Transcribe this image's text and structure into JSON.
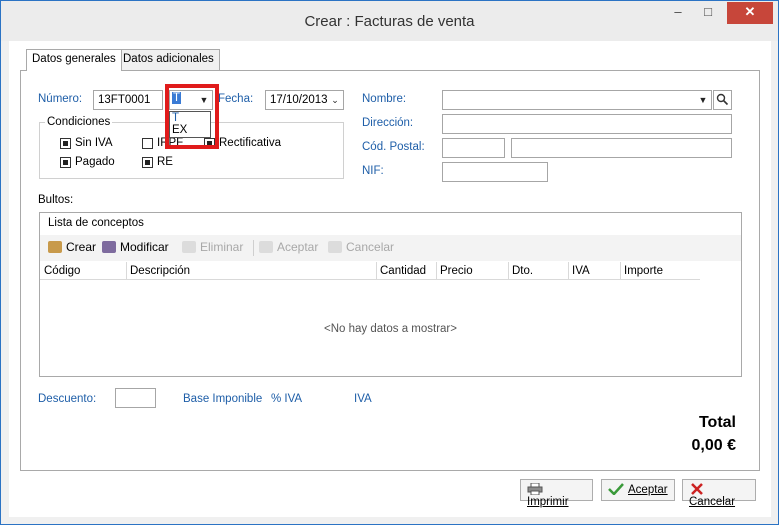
{
  "window": {
    "title": "Crear : Facturas de venta",
    "minimize": "–",
    "maximize": "□",
    "close": "✕"
  },
  "tabs": [
    {
      "label": "Datos generales"
    },
    {
      "label": "Datos adicionales"
    }
  ],
  "form": {
    "numero_label": "Número:",
    "numero_value": "13FT0001",
    "serie_value": "T",
    "serie_options": [
      "T",
      "EX"
    ],
    "fecha_label": "Fecha:",
    "fecha_value": "17/10/2013",
    "condiciones_title": "Condiciones",
    "checkboxes": [
      {
        "label": "Sin IVA",
        "checked": true
      },
      {
        "label": "IRPF",
        "checked": false
      },
      {
        "label": "Rectificativa",
        "checked": true
      },
      {
        "label": "Pagado",
        "checked": true
      },
      {
        "label": "RE",
        "checked": true
      }
    ],
    "nombre_label": "Nombre:",
    "direccion_label": "Dirección:",
    "cod_postal_label": "Cód. Postal:",
    "nif_label": "NIF:",
    "bultos_label": "Bultos:"
  },
  "conceptos": {
    "title": "Lista de conceptos",
    "toolbar": [
      {
        "label": "Crear",
        "enabled": true
      },
      {
        "label": "Modificar",
        "enabled": true
      },
      {
        "label": "Eliminar",
        "enabled": false
      },
      {
        "label": "Aceptar",
        "enabled": false
      },
      {
        "label": "Cancelar",
        "enabled": false
      }
    ],
    "columns": [
      "Código",
      "Descripción",
      "Cantidad",
      "Precio",
      "Dto.",
      "IVA",
      "Importe"
    ],
    "empty_message": "<No hay datos a mostrar>"
  },
  "footer": {
    "descuento_label": "Descuento:",
    "base_label": "Base Imponible",
    "pct_iva_label": "% IVA",
    "iva_label": "IVA",
    "total_label": "Total",
    "total_value": "0,00 €"
  },
  "buttons": {
    "imprimir": "Imprimir",
    "aceptar": "Aceptar",
    "cancelar": "Cancelar"
  },
  "colors": {
    "accent": "#1e5ea8",
    "highlight": "#e01b1b",
    "close": "#c7463a"
  }
}
